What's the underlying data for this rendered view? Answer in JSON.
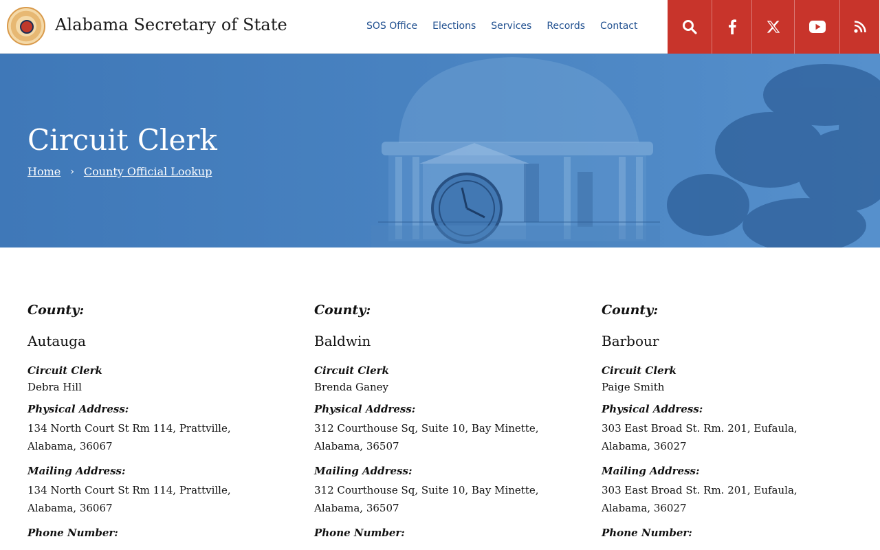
{
  "header": {
    "site_title": "Alabama Secretary of State",
    "nav": [
      "SOS Office",
      "Elections",
      "Services",
      "Records",
      "Contact"
    ],
    "social": [
      {
        "icon": "search-icon",
        "width": 64
      },
      {
        "icon": "facebook-icon",
        "width": 58
      },
      {
        "icon": "x-twitter-icon",
        "width": 62
      },
      {
        "icon": "youtube-icon",
        "width": 66
      },
      {
        "icon": "rss-icon",
        "width": 58
      }
    ],
    "accent": "#c8342b"
  },
  "hero": {
    "title": "Circuit Clerk",
    "breadcrumb": [
      "Home",
      "County Official Lookup"
    ],
    "color": "#4a84c2"
  },
  "labels": {
    "county": "County:",
    "role": "Circuit Clerk",
    "physical": "Physical Address:",
    "mailing": "Mailing Address:",
    "phone": "Phone Number:"
  },
  "counties": [
    {
      "name": "Autauga",
      "official": "Debra Hill",
      "physical": "134 North Court St Rm 114, Prattville, Alabama, 36067",
      "mailing": "134 North Court St Rm 114, Prattville, Alabama, 36067"
    },
    {
      "name": "Baldwin",
      "official": "Brenda Ganey",
      "physical": "312 Courthouse Sq, Suite 10, Bay Minette, Alabama, 36507",
      "mailing": "312 Courthouse Sq, Suite 10, Bay Minette, Alabama, 36507"
    },
    {
      "name": "Barbour",
      "official": "Paige Smith",
      "physical": "303 East Broad St. Rm. 201, Eufaula, Alabama, 36027",
      "mailing": "303 East Broad St. Rm. 201, Eufaula, Alabama, 36027"
    }
  ]
}
